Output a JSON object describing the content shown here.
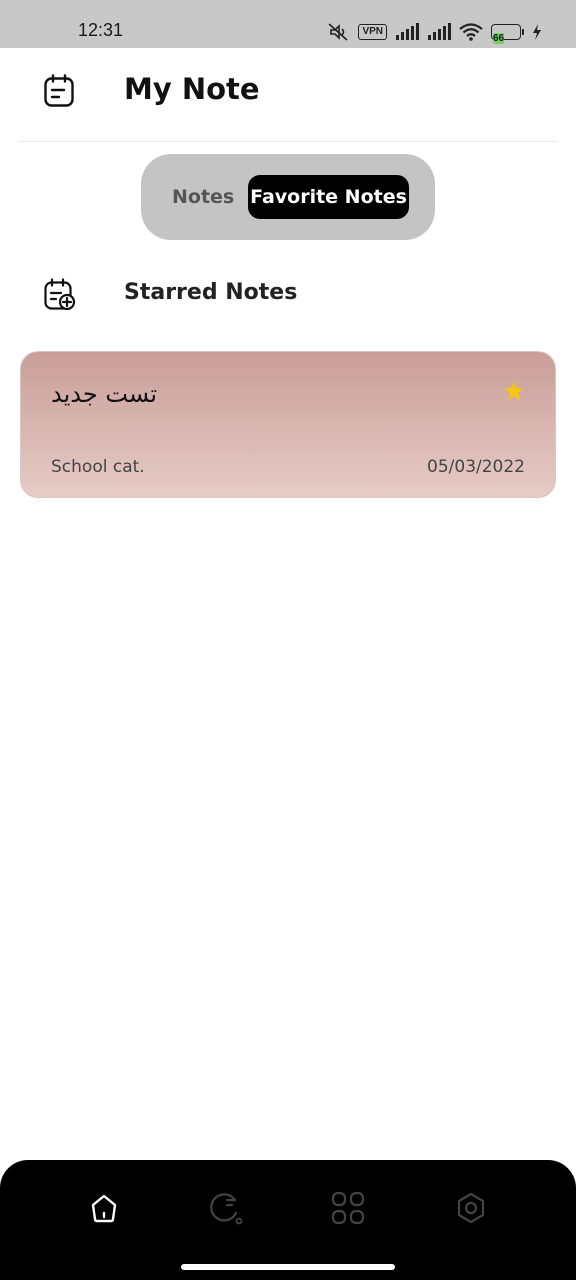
{
  "status_bar": {
    "time": "12:31",
    "vpn_label": "VPN",
    "battery_level": "66",
    "icons": [
      "mute-icon",
      "vpn-icon",
      "signal-icon",
      "signal-icon",
      "wifi-icon",
      "battery-icon",
      "charging-icon"
    ]
  },
  "header": {
    "title": "My Note",
    "icon": "note-icon"
  },
  "tabs": {
    "items": [
      {
        "label": "Notes",
        "selected": false
      },
      {
        "label": "Favorite Notes",
        "selected": true
      }
    ]
  },
  "section": {
    "title": "Starred Notes",
    "icon": "note-add-icon"
  },
  "notes": [
    {
      "title": "تست جدید",
      "category": "School cat.",
      "date": "05/03/2022",
      "starred": true
    }
  ],
  "bottom_nav": {
    "items": [
      {
        "icon": "home-icon",
        "active": true
      },
      {
        "icon": "reminder-icon",
        "active": false
      },
      {
        "icon": "categories-icon",
        "active": false
      },
      {
        "icon": "settings-icon",
        "active": false
      }
    ]
  },
  "colors": {
    "card_top": "#c99e98",
    "card_bottom": "#e6cbc6",
    "star": "#f5c518",
    "segment_bg": "#c4c4c4",
    "active_tab_bg": "#000000"
  }
}
